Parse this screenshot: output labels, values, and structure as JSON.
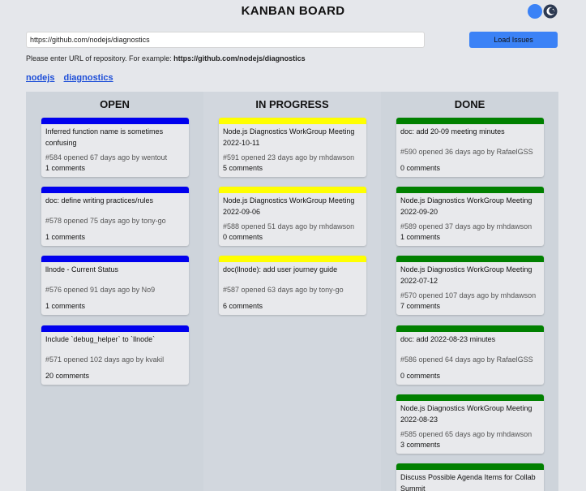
{
  "header": {
    "title": "KANBAN BOARD"
  },
  "colors": {
    "open": "#0000ee",
    "in_progress": "#ffff00",
    "done": "#008000",
    "accent": "#3b82f6"
  },
  "search": {
    "value": "https://github.com/nodejs/diagnostics",
    "placeholder": "",
    "button_label": "Load Issues",
    "hint_prefix": "Please enter URL of repository. For example: ",
    "hint_example": "https://github.com/nodejs/diagnostics"
  },
  "breadcrumb": {
    "owner": "nodejs",
    "repo": "diagnostics"
  },
  "columns": [
    {
      "title": "OPEN",
      "cards": [
        {
          "title": "Inferred function name is sometimes confusing",
          "meta": "#584 opened 67 days ago by wentout",
          "comments": "1 comments"
        },
        {
          "title": "doc: define writing practices/rules",
          "meta": "#578 opened 75 days ago by tony-go",
          "comments": "1 comments"
        },
        {
          "title": "llnode - Current Status",
          "meta": "#576 opened 91 days ago by No9",
          "comments": "1 comments"
        },
        {
          "title": "Include `debug_helper` to `llnode`",
          "meta": "#571 opened 102 days ago by kvakil",
          "comments": "20 comments"
        }
      ]
    },
    {
      "title": "IN PROGRESS",
      "cards": [
        {
          "title": "Node.js Diagnostics WorkGroup Meeting 2022-10-11",
          "meta": "#591 opened 23 days ago by mhdawson",
          "comments": "5 comments"
        },
        {
          "title": "Node.js Diagnostics WorkGroup Meeting 2022-09-06",
          "meta": "#588 opened 51 days ago by mhdawson",
          "comments": "0 comments"
        },
        {
          "title": "doc(llnode): add user journey guide",
          "meta": "#587 opened 63 days ago by tony-go",
          "comments": "6 comments"
        }
      ]
    },
    {
      "title": "DONE",
      "cards": [
        {
          "title": "doc: add 20-09 meeting minutes",
          "meta": "#590 opened 36 days ago by RafaelGSS",
          "comments": "0 comments"
        },
        {
          "title": "Node.js Diagnostics WorkGroup Meeting 2022-09-20",
          "meta": "#589 opened 37 days ago by mhdawson",
          "comments": "1 comments"
        },
        {
          "title": "Node.js Diagnostics WorkGroup Meeting 2022-07-12",
          "meta": "#570 opened 107 days ago by mhdawson",
          "comments": "7 comments"
        },
        {
          "title": "doc: add 2022-08-23 minutes",
          "meta": "#586 opened 64 days ago by RafaelGSS",
          "comments": "0 comments"
        },
        {
          "title": "Node.js Diagnostics WorkGroup Meeting 2022-08-23",
          "meta": "#585 opened 65 days ago by mhdawson",
          "comments": "3 comments"
        },
        {
          "title": "Discuss Possible Agenda Items for Collab Summit",
          "meta": "",
          "comments": ""
        }
      ]
    }
  ]
}
